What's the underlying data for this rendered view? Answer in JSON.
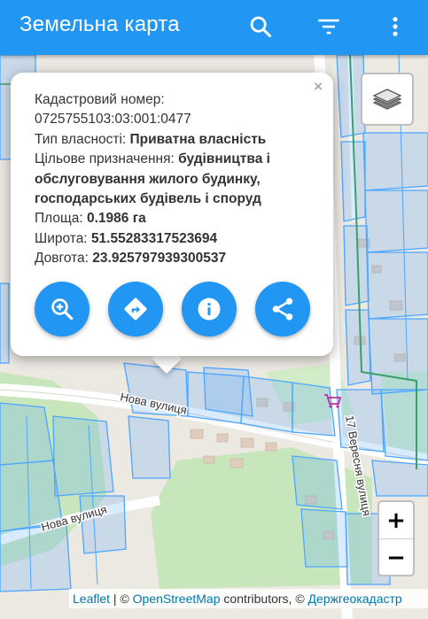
{
  "appbar": {
    "title": "Земельна карта",
    "icons": [
      "search-icon",
      "filter-icon",
      "more-vert-icon"
    ],
    "color": "#2196f3"
  },
  "popup": {
    "close_label": "×",
    "cadastral_label": "Кадастровий номер:",
    "cadastral_value": "0725755103:03:001:0477",
    "ownership_label": "Тип власності:",
    "ownership_value": "Приватна власність",
    "purpose_label": "Цільове призначення:",
    "purpose_line1": "будівництва і",
    "purpose_line2": "обслуговування жилого будинку,",
    "purpose_line3": "господарських будівель і споруд",
    "area_label": "Площа:",
    "area_value": "0.1986 га",
    "lat_label": "Широта:",
    "lat_value": "51.55283317523694",
    "lon_label": "Довгота:",
    "lon_value": "23.925797939300537",
    "actions": [
      "zoom-in-icon",
      "directions-icon",
      "info-icon",
      "share-icon"
    ]
  },
  "map": {
    "streets": [
      "Нова вулиця",
      "Нова вулиця",
      "17 Вересня вулиця"
    ],
    "parcel_color": "#4da6ff",
    "green_color": "#c8e6bc"
  },
  "zoom": {
    "in_label": "+",
    "out_label": "−"
  },
  "attribution": {
    "leaflet": "Leaflet",
    "sep1": " | © ",
    "osm": "OpenStreetMap",
    "contributors": " contributors, © ",
    "dzk": "Держгеокадастр"
  }
}
